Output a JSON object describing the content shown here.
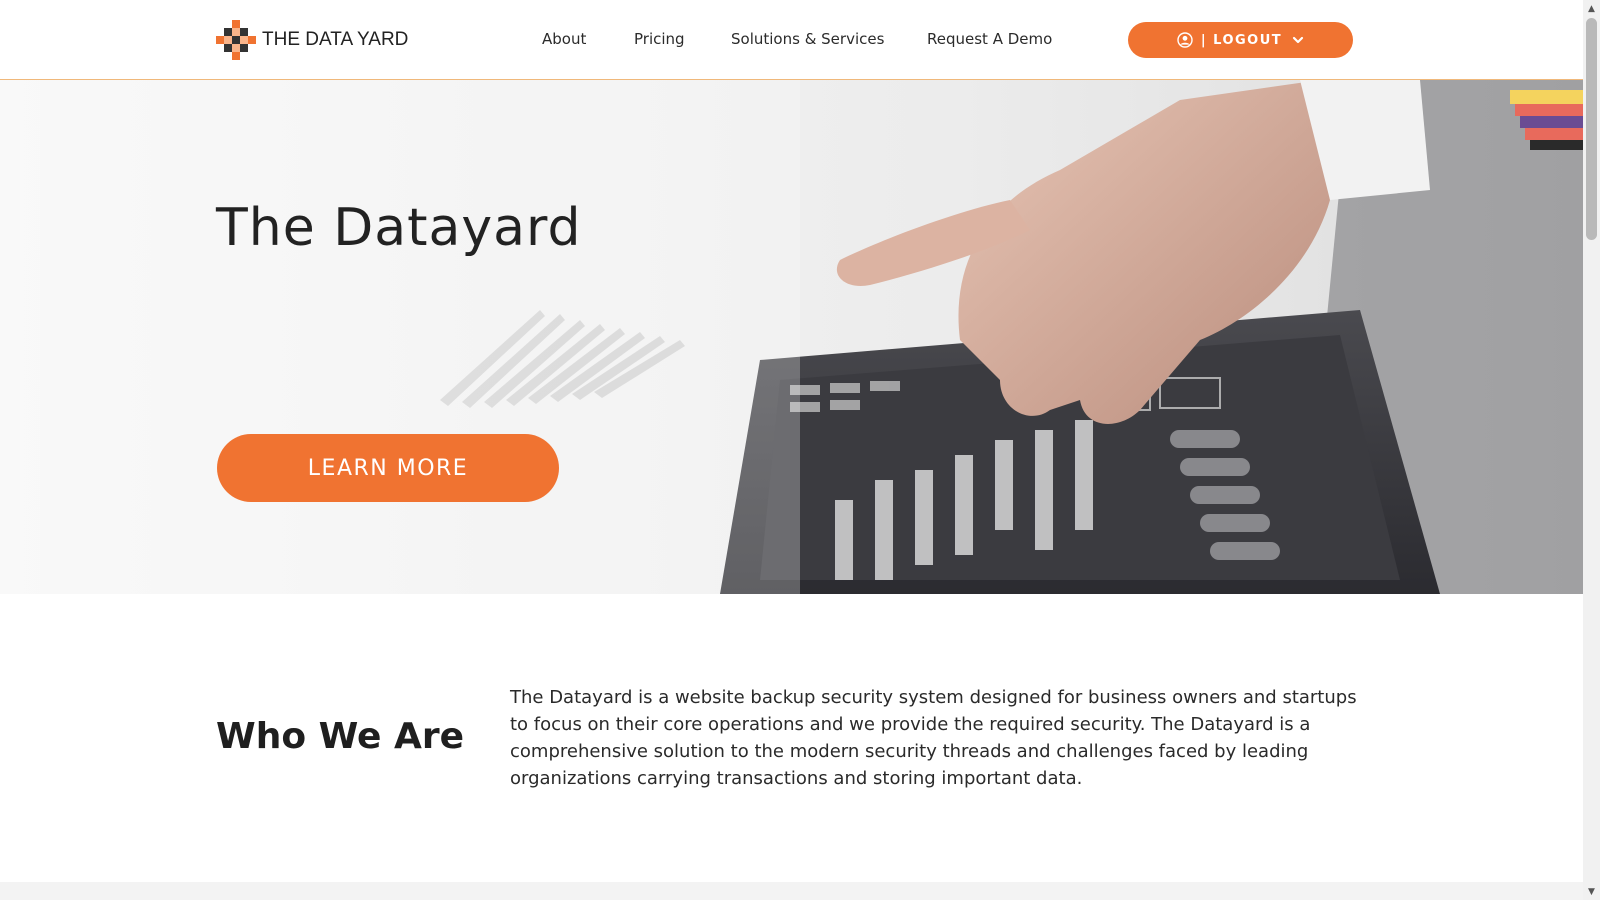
{
  "header": {
    "logo_text": "THE DATA YARD",
    "nav": [
      "About",
      "Pricing",
      "Solutions & Services",
      "Request A Demo"
    ],
    "account_label": "| LOGOUT"
  },
  "hero": {
    "title": "The Datayard",
    "button_label": "LEARN MORE"
  },
  "about": {
    "heading": "Who We Are",
    "body": "The Datayard is a website backup security system designed for business owners and startups to focus on their core operations and we provide the required security. The Datayard is a comprehensive solution to the modern security threads and challenges faced by leading organizations carrying transactions and storing important data."
  },
  "colors": {
    "accent": "#f07331",
    "header_border": "#f0b87a",
    "text": "#1d1d1d"
  },
  "icons": [
    "logo-mark-icon",
    "user-icon",
    "chevron-down-icon",
    "scroll-up-icon",
    "scroll-down-icon"
  ]
}
